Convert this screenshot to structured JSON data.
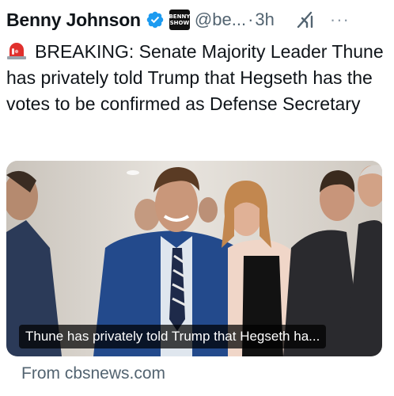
{
  "author": {
    "name": "Benny Johnson",
    "handle": "@be...",
    "separator": "·",
    "time": "3h",
    "badge_text_line1": "BENNY",
    "badge_text_line2": "SHOW"
  },
  "tweet": {
    "text": "BREAKING: Senate Majority Leader Thune has privately told Trump that Hegseth has the votes to be confirmed as Defense Secretary"
  },
  "card": {
    "caption": "Thune has privately told Trump that Hegseth ha...",
    "source": "From cbsnews.com"
  },
  "icons": {
    "verified": "verified-badge-icon",
    "grok": "grok-icon",
    "more": "more-icon",
    "siren": "siren-emoji-icon"
  },
  "colors": {
    "verified_blue": "#1d9bf0",
    "text_primary": "#0f1419",
    "text_secondary": "#536471",
    "siren_red": "#e0302d"
  }
}
